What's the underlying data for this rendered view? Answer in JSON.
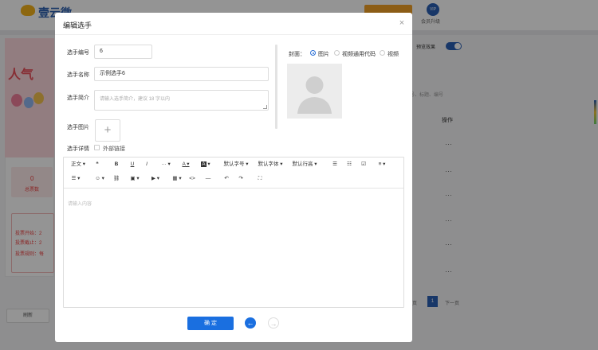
{
  "background": {
    "logo_text": "壹云微",
    "vip_label": "会员升级",
    "poster_title": "人气",
    "stat_value": "0",
    "stat_label": "总票数",
    "info_lines": [
      "投票开始：2",
      "投票截止：2",
      "投票规则：每"
    ],
    "refresh_label": "刷新",
    "preview_label": "预览效果",
    "operation_header": "操作",
    "row_action_dots": "···",
    "pager_current": "1",
    "pager_next": "下一页",
    "pager_prev": "页",
    "filter_text": "号、标题、编号"
  },
  "modal": {
    "title": "编辑选手",
    "close_glyph": "×",
    "fields": {
      "number_label": "选手编号",
      "number_value": "6",
      "name_label": "选手名称",
      "name_value": "示例选手6",
      "intro_label": "选手简介",
      "intro_placeholder": "请输入选手简介，建议 18 字以内",
      "image_label": "选手图片",
      "upload_glyph": "+",
      "detail_label": "选手详情",
      "external_link_label": "外部链接"
    },
    "cover": {
      "label": "封面：",
      "options": [
        "图片",
        "视频通用代码",
        "视频"
      ],
      "selected": "图片"
    },
    "editor": {
      "toolbar_row1": {
        "paragraph": "正文",
        "quote": "❝",
        "bold": "B",
        "underline": "U",
        "italic": "I",
        "more": "···",
        "font_color": "A",
        "bg_color": "A",
        "font_size": "默认字号",
        "font_family": "默认字体",
        "line_height": "默认行高",
        "bullet_list": "☰",
        "numbered_list": "☷",
        "todo": "☑",
        "align": "≡"
      },
      "toolbar_row2": {
        "indent": "☰",
        "emoji": "☺",
        "link": "⛓",
        "image": "▣",
        "video": "▶",
        "table": "▦",
        "code": "<>",
        "divider": "—",
        "undo": "↶",
        "redo": "↷",
        "fullscreen": "⛶"
      },
      "placeholder": "请输入内容"
    },
    "confirm_label": "确 定",
    "prev_glyph": "←",
    "next_glyph": "→"
  }
}
